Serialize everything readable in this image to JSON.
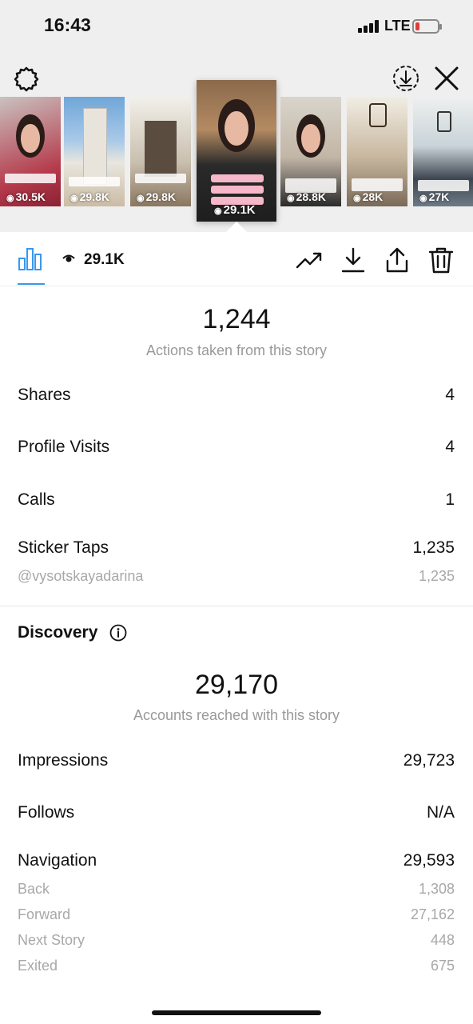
{
  "status_bar": {
    "time": "16:43",
    "network": "LTE"
  },
  "stories": [
    {
      "views": "30.5K"
    },
    {
      "views": "29.8K"
    },
    {
      "views": "29.8K"
    },
    {
      "views": "29.1K",
      "active": true
    },
    {
      "views": "28.8K"
    },
    {
      "views": "28K"
    },
    {
      "views": "27K"
    }
  ],
  "toolbar": {
    "views": "29.1K"
  },
  "interactions": {
    "total": "1,244",
    "subtitle": "Actions taken from this story",
    "shares_label": "Shares",
    "shares_value": "4",
    "profile_visits_label": "Profile Visits",
    "profile_visits_value": "4",
    "calls_label": "Calls",
    "calls_value": "1",
    "sticker_taps_label": "Sticker Taps",
    "sticker_taps_value": "1,235",
    "sticker_handle": "@vysotskayadarina",
    "sticker_handle_value": "1,235"
  },
  "discovery": {
    "title": "Discovery",
    "reached": "29,170",
    "reached_subtitle": "Accounts reached with this story",
    "impressions_label": "Impressions",
    "impressions_value": "29,723",
    "follows_label": "Follows",
    "follows_value": "N/A",
    "navigation_label": "Navigation",
    "navigation_value": "29,593",
    "back_label": "Back",
    "back_value": "1,308",
    "forward_label": "Forward",
    "forward_value": "27,162",
    "next_story_label": "Next Story",
    "next_story_value": "448",
    "exited_label": "Exited",
    "exited_value": "675"
  },
  "colors": {
    "accent": "#3897f0",
    "muted": "#999999"
  }
}
